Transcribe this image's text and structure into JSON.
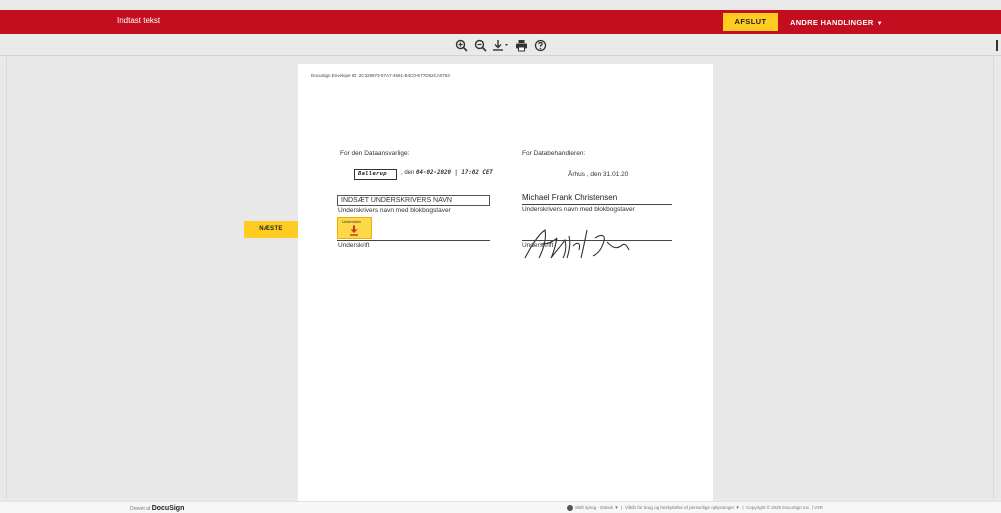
{
  "header": {
    "title": "Indtast tekst",
    "finish_label": "AFSLUT",
    "other_actions_label": "ANDRE HANDLINGER",
    "other_actions_caret": "▼"
  },
  "toolbar": {
    "tools": [
      "zoom-in-icon",
      "zoom-out-icon",
      "download-icon",
      "print-icon",
      "help-icon"
    ]
  },
  "viewer": {
    "next_label": "NÆSTE"
  },
  "document": {
    "envelope_id": "DocuSign Envelope ID: 2C328973-57A7-4561-B4C0-E77D52CA0754",
    "left": {
      "heading": "For den Dataansvarlige:",
      "city_value": "Ballerup",
      "date_prefix": ", den",
      "date_value": "04-02-2020 | 17:02 CET",
      "name_placeholder": "INDSÆT UNDERSKRIVERS NAVN",
      "name_caption": "Underskrivers navn med blokbogstaver",
      "sign_widget_label": "Underskriv",
      "signature_caption": "Underskrift"
    },
    "right": {
      "heading": "For Databehandleren:",
      "place_date": "Århus , den 31.01.20",
      "signer_name": "Michael Frank Christensen",
      "name_caption": "Underskrivers navn med blokbogstaver",
      "signature_caption": "Underskrift"
    }
  },
  "footer": {
    "powered_prefix": "Drevet af",
    "powered_brand": "DocuSign",
    "language": "Skift sprog - Dansk",
    "language_caret": "▼",
    "terms": "Vilkår for brug og beskyttelse af personlige oplysninger",
    "terms_caret": "▼",
    "copyright": "Copyright © 2020 DocuSign Inc. | V2R"
  },
  "colors": {
    "brand_red": "#c30e20",
    "accent_yellow": "#ffcc22"
  }
}
